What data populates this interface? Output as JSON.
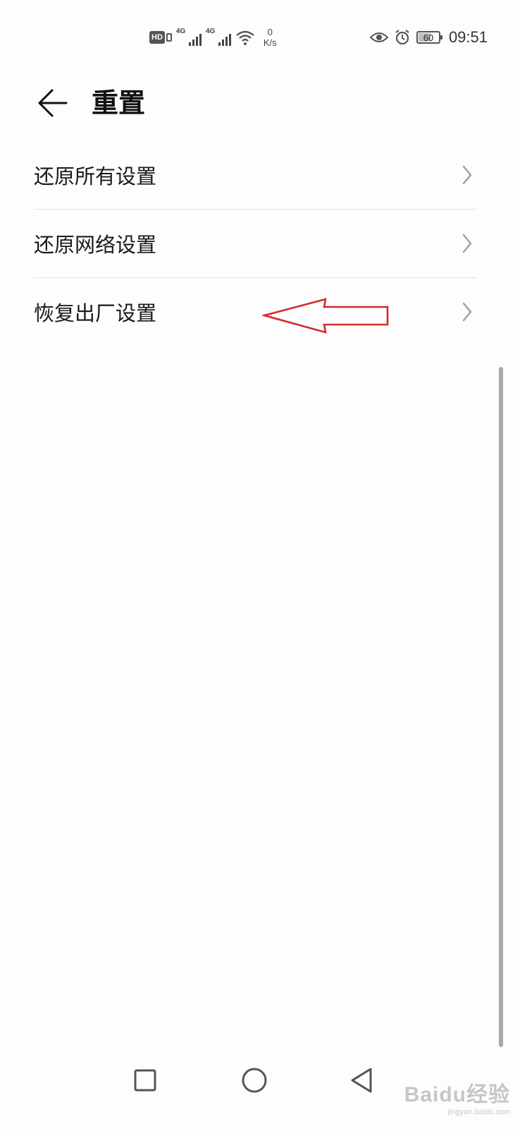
{
  "status_bar": {
    "hd_label": "HD",
    "sim1_network": "4G",
    "sim2_network": "4G",
    "net_speed_value": "0",
    "net_speed_unit": "K/s",
    "battery_level": "60",
    "battery_fraction": 0.6,
    "time": "09:51",
    "icons": [
      "hd-volte-icon",
      "signal-icon",
      "signal-icon",
      "wifi-icon",
      "eye-comfort-icon",
      "alarm-icon",
      "battery-icon"
    ]
  },
  "header": {
    "back_icon": "arrow-left-icon",
    "title": "重置"
  },
  "list": {
    "items": [
      {
        "label": "还原所有设置",
        "icon": "chevron-right-icon"
      },
      {
        "label": "还原网络设置",
        "icon": "chevron-right-icon"
      },
      {
        "label": "恢复出厂设置",
        "icon": "chevron-right-icon"
      }
    ]
  },
  "annotation": {
    "icon": "red-arrow-left-icon",
    "color": "#d42a2a",
    "points_to": "恢复出厂设置"
  },
  "navbar": {
    "icons": [
      "square-recents-icon",
      "circle-home-icon",
      "triangle-back-icon"
    ]
  },
  "watermark": {
    "logo": "Baidu经验",
    "url": "jingyan.baidu.com"
  },
  "colors": {
    "background": "#fdfdfd",
    "text": "#1a1a1a",
    "divider": "#e2e2e2",
    "icon_gray": "#555555"
  }
}
